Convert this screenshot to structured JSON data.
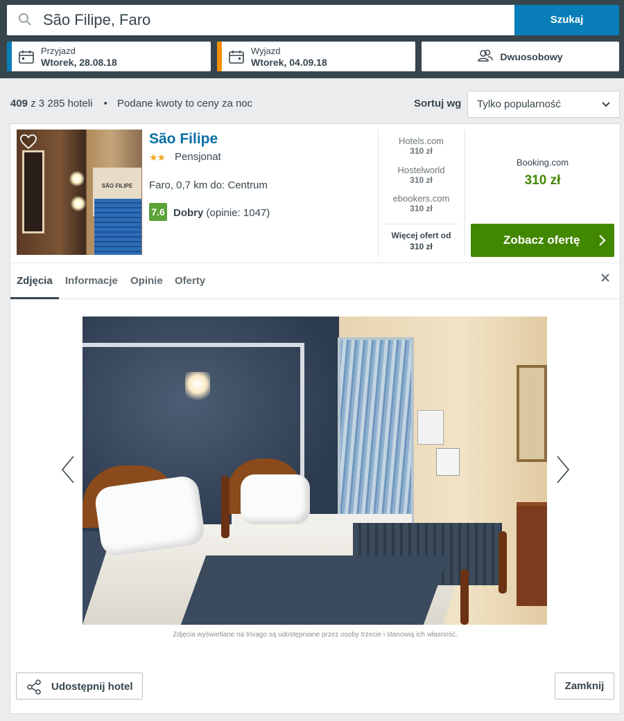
{
  "search": {
    "value": "São Filipe, Faro",
    "button_label": "Szukaj"
  },
  "checkin": {
    "label": "Przyjazd",
    "value": "Wtorek, 28.08.18",
    "accent": "#0a7eb8"
  },
  "checkout": {
    "label": "Wyjazd",
    "value": "Wtorek, 04.09.18",
    "accent": "#f48f00"
  },
  "room": {
    "label": "Dwuosobowy"
  },
  "results": {
    "count": "409",
    "total": "z 3 285 hoteli",
    "bullet": "•",
    "note": "Podane kwoty to ceny za noc"
  },
  "sort": {
    "label": "Sortuj wg",
    "value": "Tylko popularność"
  },
  "hotel": {
    "name": "São Filipe",
    "stars_glyph": "★★",
    "star_count": 2,
    "type": "Pensjonat",
    "location": "Faro, 0,7 km do: Centrum",
    "rating": "7.6",
    "rating_label": "Dobry",
    "reviews": "(opinie: 1047)",
    "thumb_sign": "SÃO FILIPE"
  },
  "offers": [
    {
      "site": "Hotels.com",
      "price": "310 zł"
    },
    {
      "site": "Hostelworld",
      "price": "310 zł"
    },
    {
      "site": "ebookers.com",
      "price": "310 zł"
    }
  ],
  "more_offers": {
    "label": "Więcej ofert od",
    "price": "310 zł"
  },
  "main_offer": {
    "site": "Booking.com",
    "price": "310 zł",
    "button_label": "Zobacz ofertę"
  },
  "tabs": [
    {
      "label": "Zdjęcia",
      "active": true
    },
    {
      "label": "Informacje",
      "active": false
    },
    {
      "label": "Opinie",
      "active": false
    },
    {
      "label": "Oferty",
      "active": false
    }
  ],
  "gallery": {
    "caption": "Zdjęcia wyświetlane na trivago są udostępniane przez osoby trzecie i stanowią ich własność."
  },
  "footer": {
    "share_label": "Udostępnij hotel",
    "close_label": "Zamknij"
  },
  "colors": {
    "header": "#37454d",
    "brand_blue": "#0a7eb8",
    "deal_green": "#428700",
    "rating_green": "#5ba237"
  }
}
